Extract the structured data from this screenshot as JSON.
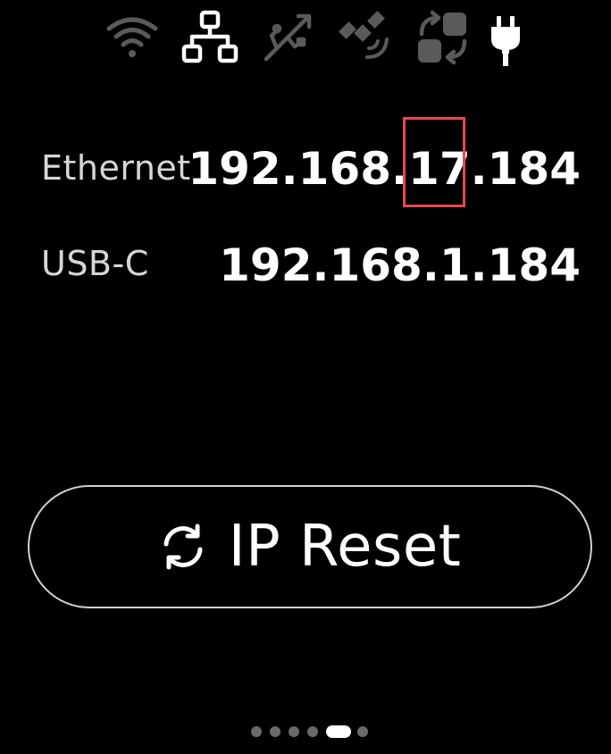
{
  "status_bar": {
    "icons": [
      {
        "name": "wifi-icon",
        "state": "inactive"
      },
      {
        "name": "ethernet-network-icon",
        "state": "active"
      },
      {
        "name": "usb-icon",
        "state": "inactive"
      },
      {
        "name": "satellite-icon",
        "state": "inactive"
      },
      {
        "name": "sync-transfer-icon",
        "state": "inactive"
      },
      {
        "name": "power-plug-icon",
        "state": "active"
      }
    ]
  },
  "connections": [
    {
      "label": "Ethernet",
      "ip_prefix": "192.168.",
      "ip_highlight": "17.",
      "ip_suffix": "184"
    },
    {
      "label": "USB-C",
      "ip": "192.168.1.184"
    }
  ],
  "reset_button": {
    "label": "IP Reset",
    "icon": "refresh-icon"
  },
  "pager": {
    "total": 6,
    "active_index": 4
  },
  "colors": {
    "background": "#000000",
    "text_primary": "#ffffff",
    "text_secondary": "#d6d6d6",
    "icon_inactive": "#5a5a5a",
    "highlight_border": "#e8474c"
  }
}
